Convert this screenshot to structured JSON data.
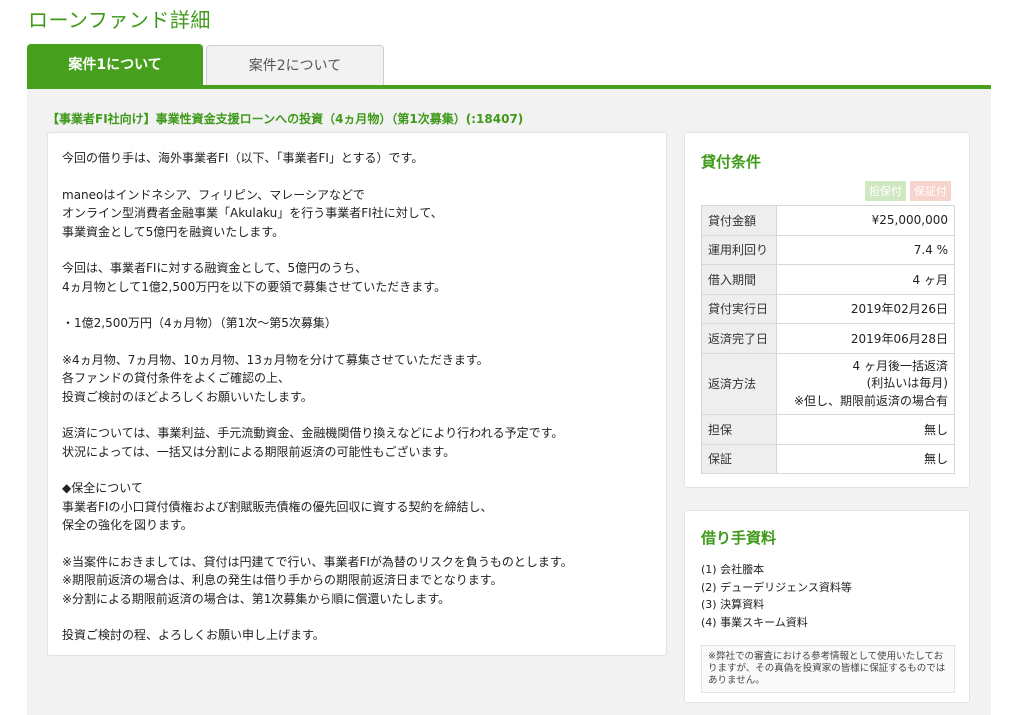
{
  "page_title": "ローンファンド詳細",
  "tabs": [
    {
      "label": "案件1について",
      "active": true
    },
    {
      "label": "案件2について",
      "active": false
    }
  ],
  "fund_title": "【事業者FI社向け】事業性資金支援ローンへの投資（4ヵ月物）（第1次募集）(:18407)",
  "description": [
    "今回の借り手は、海外事業者FI（以下、「事業者FI」とする）です。",
    "maneoはインドネシア、フィリピン、マレーシアなどで\nオンライン型消費者金融事業「Akulaku」を行う事業者FI社に対して、\n事業資金として5億円を融資いたします。",
    "今回は、事業者FIに対する融資金として、5億円のうち、\n4ヵ月物として1億2,500万円を以下の要領で募集させていただきます。",
    "・1億2,500万円（4ヵ月物）（第1次〜第5次募集）",
    "※4ヵ月物、7ヵ月物、10ヵ月物、13ヵ月物を分けて募集させていただきます。\n各ファンドの貸付条件をよくご確認の上、\n投資ご検討のほどよろしくお願いいたします。",
    "返済については、事業利益、手元流動資金、金融機関借り換えなどにより行われる予定です。\n状況によっては、一括又は分割による期限前返済の可能性もございます。",
    "◆保全について\n事業者FIの小口貸付債権および割賦販売債権の優先回収に資する契約を締結し、\n保全の強化を図ります。",
    "※当案件におきましては、貸付は円建てで行い、事業者FIが為替のリスクを負うものとします。\n※期限前返済の場合は、利息の発生は借り手からの期限前返済日までとなります。\n※分割による期限前返済の場合は、第1次募集から順に償還いたします。",
    "投資ご検討の程、よろしくお願い申し上げます。"
  ],
  "conditions": {
    "heading": "貸付条件",
    "badges": [
      "担保付",
      "保証付"
    ],
    "rows": [
      {
        "label": "貸付金額",
        "value": "¥25,000,000"
      },
      {
        "label": "運用利回り",
        "value": "7.4 %"
      },
      {
        "label": "借入期間",
        "value": "4 ヶ月"
      },
      {
        "label": "貸付実行日",
        "value": "2019年02月26日"
      },
      {
        "label": "返済完了日",
        "value": "2019年06月28日"
      },
      {
        "label": "返済方法",
        "value": "4 ヶ月後一括返済\n(利払いは毎月)\n※但し、期限前返済の場合有"
      },
      {
        "label": "担保",
        "value": "無し"
      },
      {
        "label": "保証",
        "value": "無し"
      }
    ]
  },
  "documents": {
    "heading": "借り手資料",
    "items": [
      "(1) 会社謄本",
      "(2) デューデリジェンス資料等",
      "(3) 決算資料",
      "(4) 事業スキーム資料"
    ],
    "disclaimer": "※弊社での審査における参考情報として使用いたしておりますが、その真偽を投資家の皆様に保証するものではありません。"
  }
}
